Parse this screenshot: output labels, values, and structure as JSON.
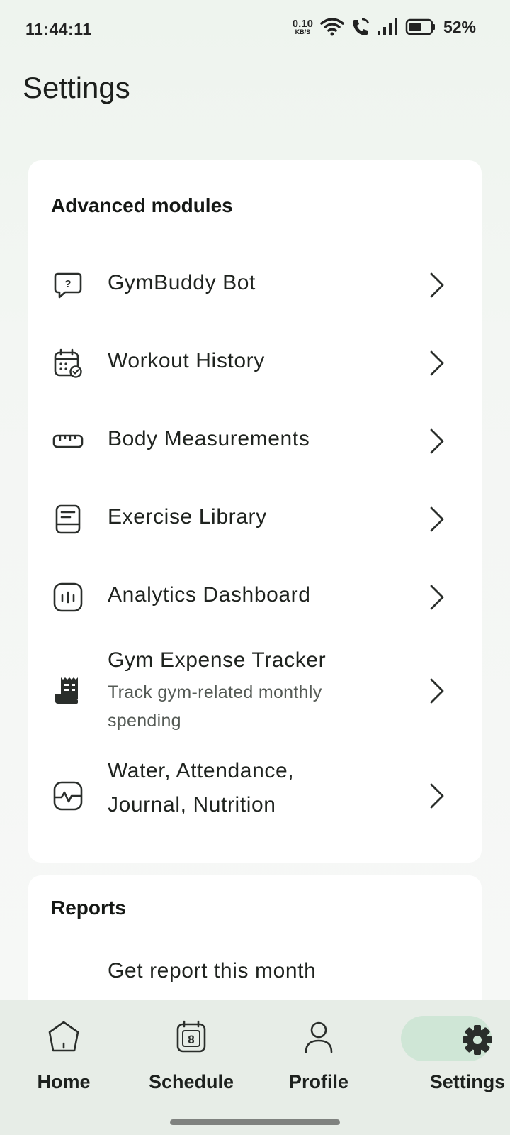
{
  "status_bar": {
    "time": "11:44:11",
    "net_speed_value": "0.10",
    "net_speed_unit": "KB/S",
    "battery_percent": "52%"
  },
  "page": {
    "title": "Settings"
  },
  "advanced": {
    "title": "Advanced modules",
    "items": [
      {
        "label": "GymBuddy Bot",
        "icon": "chat-question-icon"
      },
      {
        "label": "Workout History",
        "icon": "calendar-check-icon"
      },
      {
        "label": "Body Measurements",
        "icon": "ruler-icon"
      },
      {
        "label": "Exercise Library",
        "icon": "book-icon"
      },
      {
        "label": "Analytics Dashboard",
        "icon": "bar-chart-icon"
      },
      {
        "label": "Gym Expense Tracker",
        "subtitle": "Track gym-related monthly spending",
        "icon": "receipt-icon"
      },
      {
        "label_line1": "Water, Attendance,",
        "label_line2": "Journal, Nutrition",
        "icon": "pulse-icon"
      }
    ]
  },
  "reports": {
    "title": "Reports",
    "items": [
      {
        "label": "Get report this month"
      }
    ]
  },
  "bottom_nav": {
    "items": [
      {
        "label": "Home",
        "icon": "home-icon"
      },
      {
        "label": "Schedule",
        "icon": "calendar-icon",
        "badge": "8"
      },
      {
        "label": "Profile",
        "icon": "person-icon"
      },
      {
        "label": "Settings",
        "icon": "gear-icon",
        "active": true
      }
    ]
  },
  "colors": {
    "accent_pill": "#cfe6d6",
    "nav_bg": "#e7ede7"
  }
}
